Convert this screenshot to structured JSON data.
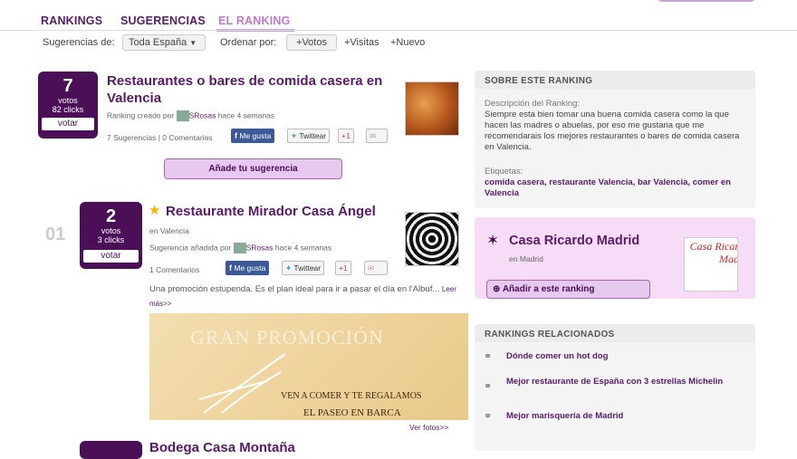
{
  "tabs": {
    "rankings": "RANKINGS",
    "sugerencias": "SUGERENCIAS",
    "el_ranking": "EL RANKING"
  },
  "filters": {
    "sugerencias_label": "Sugerencias de:",
    "region": "Toda España",
    "ordenar_label": "Ordenar por:",
    "votos": "+Votos",
    "visitas": "+Visitas",
    "nuevo": "+Nuevo"
  },
  "ranking": {
    "votes": "7",
    "votes_label": "votos",
    "clicks": "82 clicks",
    "vote_btn": "votar",
    "title": "Restaurantes o bares de comida casera en Valencia",
    "created_by": "Ranking creado por",
    "author": "SRosas",
    "time": "hace 4 semanas",
    "stats": "7 Sugerencias | 0 Comentarios",
    "add_btn": "Añade tu sugerencia"
  },
  "share": {
    "facebook": "Me gusta",
    "twitter": "Twittear",
    "gplus": "+1"
  },
  "entry1": {
    "rank": "01",
    "votes": "2",
    "votes_label": "votos",
    "clicks": "3 clicks",
    "vote_btn": "votar",
    "title": "Restaurante Mirador Casa Ángel",
    "location": "en Valencia",
    "added_by": "Sugerencia añadida por",
    "author": "SRosas",
    "time": "hace 4 semanas",
    "comments": "1 Comentarios",
    "desc": "Una promoción estupenda. Es el plan ideal para ir a pasar el día en l'Albuf...",
    "more": "Leer más>>",
    "photos": "Ver fotos>>",
    "promo_title": "GRAN PROMOCIÓN",
    "promo_line1": "VEN A COMER Y TE REGALAMOS",
    "promo_line2": "EL PASEO EN BARCA"
  },
  "entry2": {
    "title": "Bodega Casa Montaña"
  },
  "about": {
    "header": "SOBRE ESTE RANKING",
    "desc_label": "Descripción del Ranking:",
    "desc": "Siempre esta bien tomar una buena comida casera como la que hacen las madres o abuelas, por eso me gustaria que me recomendarais los mejores restaurantes o bares de comida casera en Valencia.",
    "tags_label": "Etiquetas:",
    "tags": "comida casera, restaurante Valencia, bar Valencia, comer en Valencia"
  },
  "featured": {
    "title": "Casa Ricardo Madrid",
    "location": "en Madrid",
    "add_btn": "Añadir a este ranking",
    "logo_text": "Casa Ricar Mad"
  },
  "related": {
    "header": "RANKINGS RELACIONADOS",
    "items": [
      "Dónde comer un hot dog",
      "Mejor restaurante de España con 3 estrellas Michelin",
      "Mejor marisquería de Madrid"
    ]
  },
  "colors": {
    "brand": "#4a0f57",
    "accent": "#c9a0d8"
  }
}
